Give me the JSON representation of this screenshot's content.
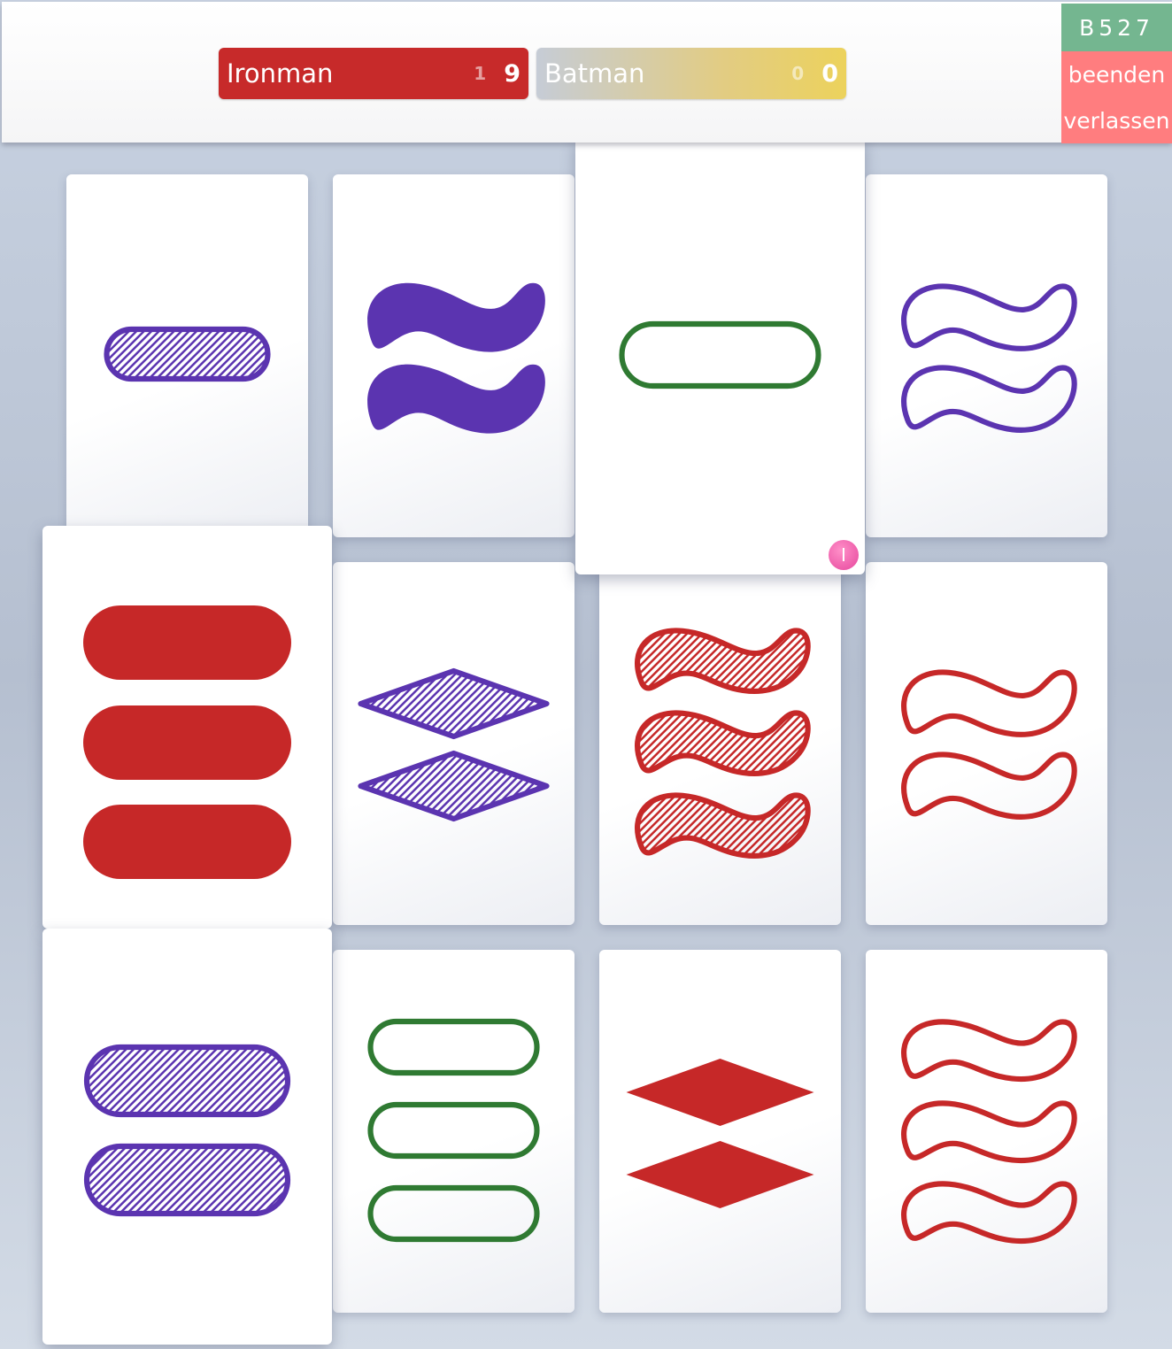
{
  "room": {
    "code": "B527",
    "end_label": "beenden",
    "leave_label": "verlassen"
  },
  "players": [
    {
      "name": "Ironman",
      "sets": "1",
      "score": "9",
      "color": "#c72a2a"
    },
    {
      "name": "Batman",
      "sets": "0",
      "score": "0",
      "color": "#ecd25c"
    }
  ],
  "colors": {
    "red": "#c62828",
    "purple": "#5b34b0",
    "green": "#2f7a32"
  },
  "selection_badge": "I",
  "cards": [
    {
      "id": 1,
      "count": 1,
      "shape": "oval",
      "fill": "striped",
      "color": "purple",
      "selected": false
    },
    {
      "id": 2,
      "count": 2,
      "shape": "squiggle",
      "fill": "solid",
      "color": "purple",
      "selected": false
    },
    {
      "id": 3,
      "count": 1,
      "shape": "oval",
      "fill": "open",
      "color": "green",
      "selected": true
    },
    {
      "id": 4,
      "count": 2,
      "shape": "squiggle",
      "fill": "open",
      "color": "purple",
      "selected": false
    },
    {
      "id": 5,
      "count": 3,
      "shape": "oval",
      "fill": "solid",
      "color": "red",
      "selected": true
    },
    {
      "id": 6,
      "count": 2,
      "shape": "diamond",
      "fill": "striped",
      "color": "purple",
      "selected": false
    },
    {
      "id": 7,
      "count": 3,
      "shape": "squiggle",
      "fill": "striped",
      "color": "red",
      "selected": false
    },
    {
      "id": 8,
      "count": 2,
      "shape": "squiggle",
      "fill": "open",
      "color": "red",
      "selected": false
    },
    {
      "id": 9,
      "count": 2,
      "shape": "oval",
      "fill": "striped",
      "color": "purple",
      "selected": true
    },
    {
      "id": 10,
      "count": 3,
      "shape": "oval",
      "fill": "open",
      "color": "green",
      "selected": false
    },
    {
      "id": 11,
      "count": 2,
      "shape": "diamond",
      "fill": "solid",
      "color": "red",
      "selected": false
    },
    {
      "id": 12,
      "count": 3,
      "shape": "squiggle",
      "fill": "open",
      "color": "red",
      "selected": false
    }
  ]
}
